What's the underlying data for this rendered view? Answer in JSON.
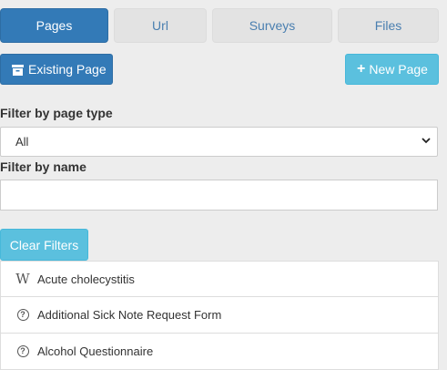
{
  "tabs": [
    "Pages",
    "Url",
    "Surveys",
    "Files"
  ],
  "toolbar": {
    "existing_page_label": "Existing Page",
    "new_page_label": "New Page",
    "new_page_icon": "+"
  },
  "filters": {
    "page_type_label": "Filter by page type",
    "page_type_value": "All",
    "name_label": "Filter by name",
    "name_value": "",
    "clear_label": "Clear Filters"
  },
  "list": {
    "items": [
      {
        "icon": "wikipedia-icon",
        "glyph": "W",
        "label": "Acute cholecystitis"
      },
      {
        "icon": "question-circle-icon",
        "glyph": "?",
        "label": "Additional Sick Note Request Form"
      },
      {
        "icon": "question-circle-icon",
        "glyph": "?",
        "label": "Alcohol Questionnaire"
      }
    ]
  },
  "colors": {
    "primary": "#337ab7",
    "info": "#5bc0de",
    "background": "#ededed"
  }
}
